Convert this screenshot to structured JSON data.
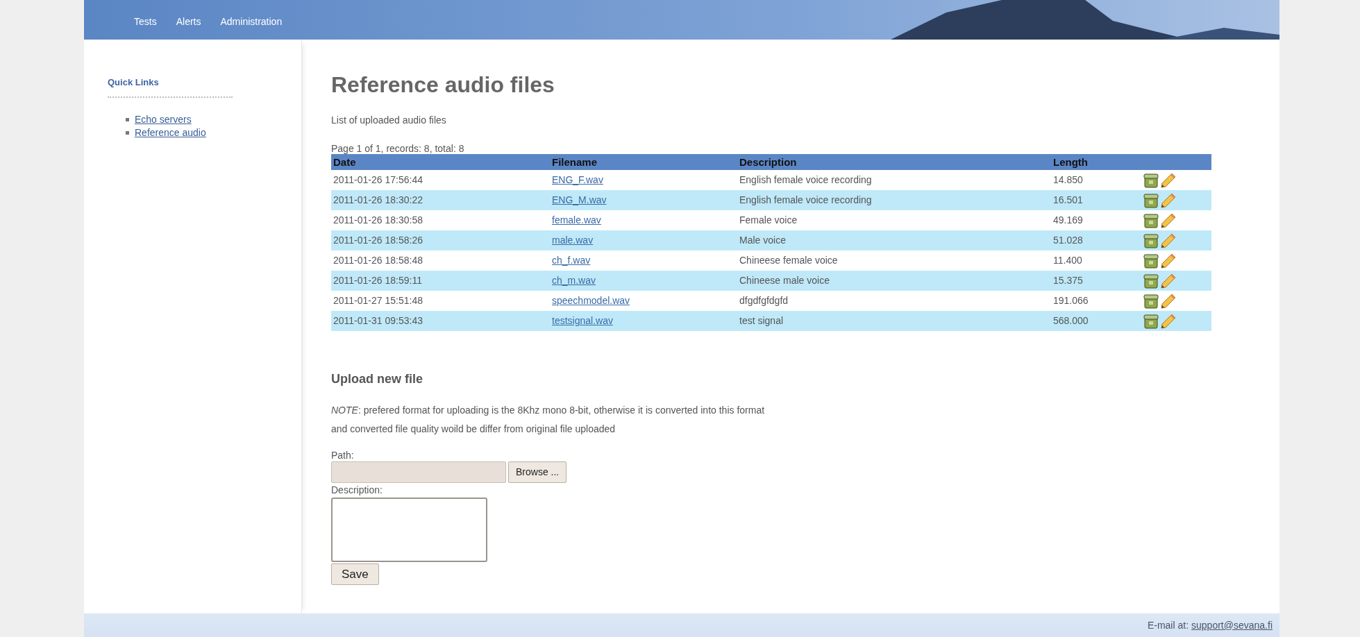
{
  "nav": {
    "items": [
      "Tests",
      "Alerts",
      "Administration"
    ]
  },
  "sidebar": {
    "title": "Quick Links",
    "links": [
      "Echo servers",
      "Reference audio"
    ]
  },
  "page": {
    "title": "Reference audio files",
    "subtitle": "List of uploaded audio files",
    "pager": "Page 1 of 1, records: 8, total: 8"
  },
  "table": {
    "columns": [
      "Date",
      "Filename",
      "Description",
      "Length"
    ],
    "rows": [
      {
        "date": "2011-01-26 17:56:44",
        "filename": "ENG_F.wav",
        "description": "English female voice recording",
        "length": "14.850"
      },
      {
        "date": "2011-01-26 18:30:22",
        "filename": "ENG_M.wav",
        "description": "English female voice recording",
        "length": "16.501"
      },
      {
        "date": "2011-01-26 18:30:58",
        "filename": "female.wav",
        "description": "Female voice",
        "length": "49.169"
      },
      {
        "date": "2011-01-26 18:58:26",
        "filename": "male.wav",
        "description": "Male voice",
        "length": "51.028"
      },
      {
        "date": "2011-01-26 18:58:48",
        "filename": "ch_f.wav",
        "description": "Chineese female voice",
        "length": "11.400"
      },
      {
        "date": "2011-01-26 18:59:11",
        "filename": "ch_m.wav",
        "description": "Chineese male voice",
        "length": "15.375"
      },
      {
        "date": "2011-01-27 15:51:48",
        "filename": "speechmodel.wav",
        "description": "dfgdfgfdgfd",
        "length": "191.066"
      },
      {
        "date": "2011-01-31 09:53:43",
        "filename": "testsignal.wav",
        "description": "test signal",
        "length": "568.000"
      }
    ]
  },
  "upload": {
    "title": "Upload new file",
    "note": "*NOTE*: prefered format for uploading is the 8Khz mono 8-bit, otherwise it is converted into this format and converted file quality woild be differ from original file uploaded",
    "path_label": "Path:",
    "browse_button": "Browse ...",
    "description_label": "Description:",
    "save_button": "Save"
  },
  "footer": {
    "label": "E-mail at:",
    "email": "support@sevana.fi"
  }
}
